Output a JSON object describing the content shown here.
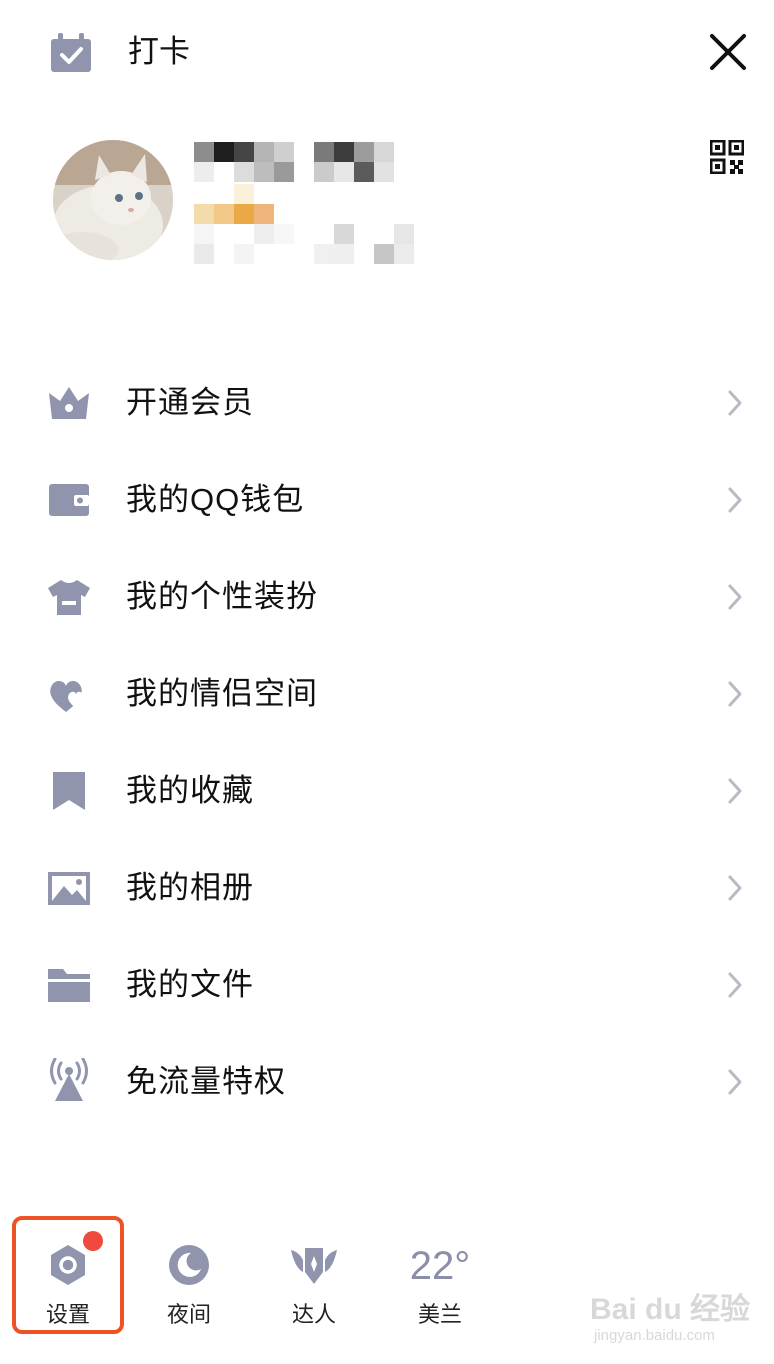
{
  "header": {
    "checkin_label": "打卡",
    "checkin_icon": "calendar-check-icon",
    "close_icon": "close-icon",
    "qr_icon": "qr-code-icon"
  },
  "colors": {
    "icon": "#9095ad",
    "text": "#111111",
    "chevron": "#b8bac4",
    "highlight": "#ee5325",
    "badge": "#f04a3e"
  },
  "menu": {
    "items": [
      {
        "label": "开通会员",
        "icon": "crown-icon"
      },
      {
        "label": "我的QQ钱包",
        "icon": "wallet-icon"
      },
      {
        "label": "我的个性装扮",
        "icon": "shirt-icon"
      },
      {
        "label": "我的情侣空间",
        "icon": "hearts-icon"
      },
      {
        "label": "我的收藏",
        "icon": "bookmark-icon"
      },
      {
        "label": "我的相册",
        "icon": "photo-icon"
      },
      {
        "label": "我的文件",
        "icon": "folder-icon"
      },
      {
        "label": "免流量特权",
        "icon": "signal-tower-icon"
      }
    ]
  },
  "bottom": {
    "settings_label": "设置",
    "night_label": "夜间",
    "expert_label": "达人",
    "weather_temp": "22°",
    "weather_city": "美兰"
  },
  "watermark": {
    "text": "Bai du 经验",
    "url": "jingyan.baidu.com"
  }
}
